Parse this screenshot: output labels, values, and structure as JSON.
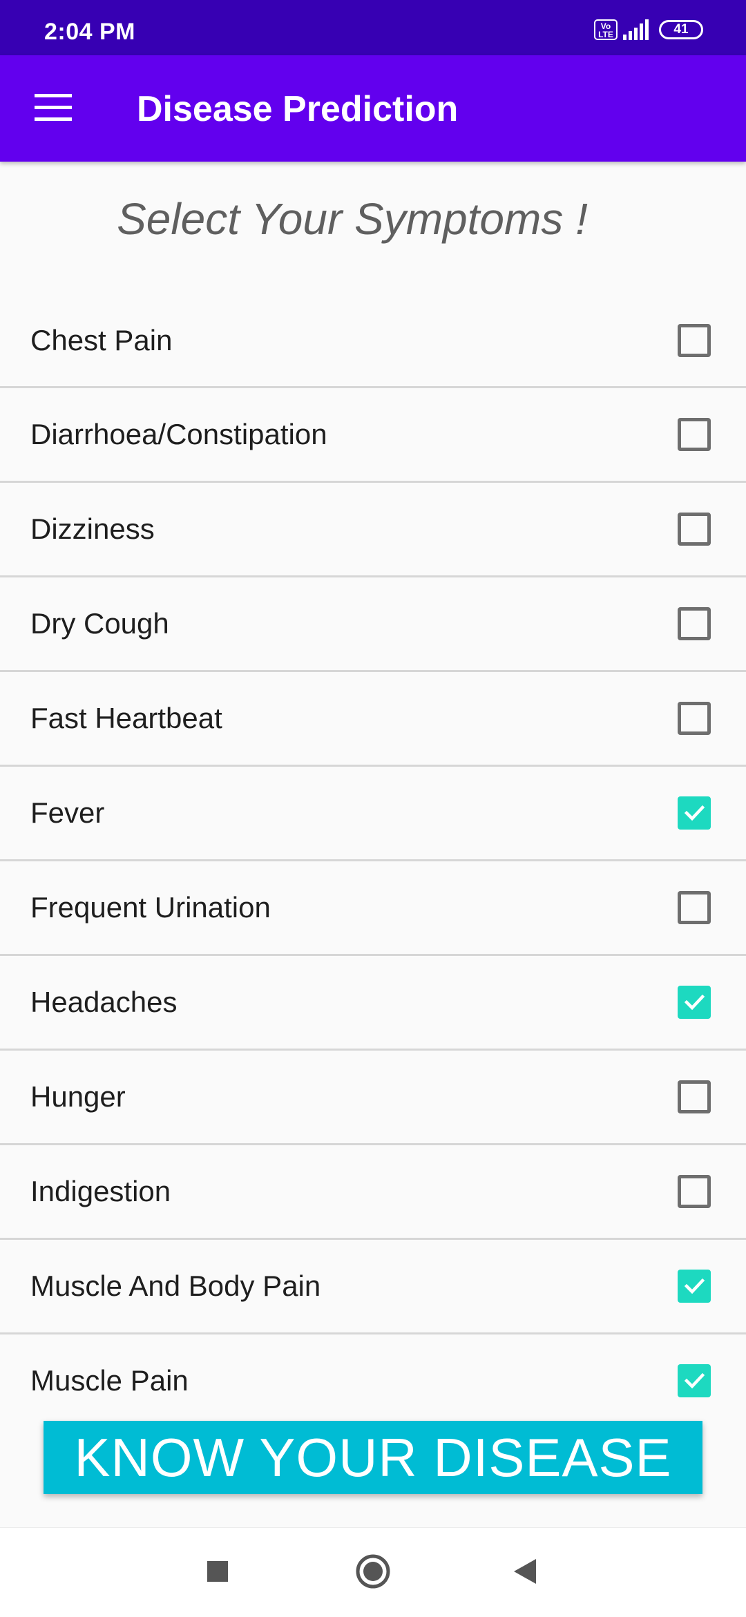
{
  "status_bar": {
    "time": "2:04 PM",
    "volte_label": "Vo\nLTE",
    "battery_level": "41"
  },
  "app_bar": {
    "title": "Disease Prediction",
    "menu_icon": "hamburger-menu-icon"
  },
  "heading": "Select Your Symptoms !",
  "symptoms": [
    {
      "label": "Chest Pain",
      "checked": false
    },
    {
      "label": "Diarrhoea/Constipation",
      "checked": false
    },
    {
      "label": "Dizziness",
      "checked": false
    },
    {
      "label": "Dry Cough",
      "checked": false
    },
    {
      "label": "Fast Heartbeat",
      "checked": false
    },
    {
      "label": "Fever",
      "checked": true
    },
    {
      "label": "Frequent Urination",
      "checked": false
    },
    {
      "label": "Headaches",
      "checked": true
    },
    {
      "label": "Hunger",
      "checked": false
    },
    {
      "label": "Indigestion",
      "checked": false
    },
    {
      "label": "Muscle And Body Pain",
      "checked": true
    },
    {
      "label": "Muscle Pain",
      "checked": true
    }
  ],
  "cta_label": "KNOW YOUR DISEASE",
  "colors": {
    "status_bar": "#3700b3",
    "app_bar": "#6200ee",
    "checkbox_checked": "#1dd9c0",
    "cta": "#00bcd4"
  },
  "nav_bar": {
    "icons": [
      "recents-square-icon",
      "home-circle-icon",
      "back-triangle-icon"
    ]
  }
}
